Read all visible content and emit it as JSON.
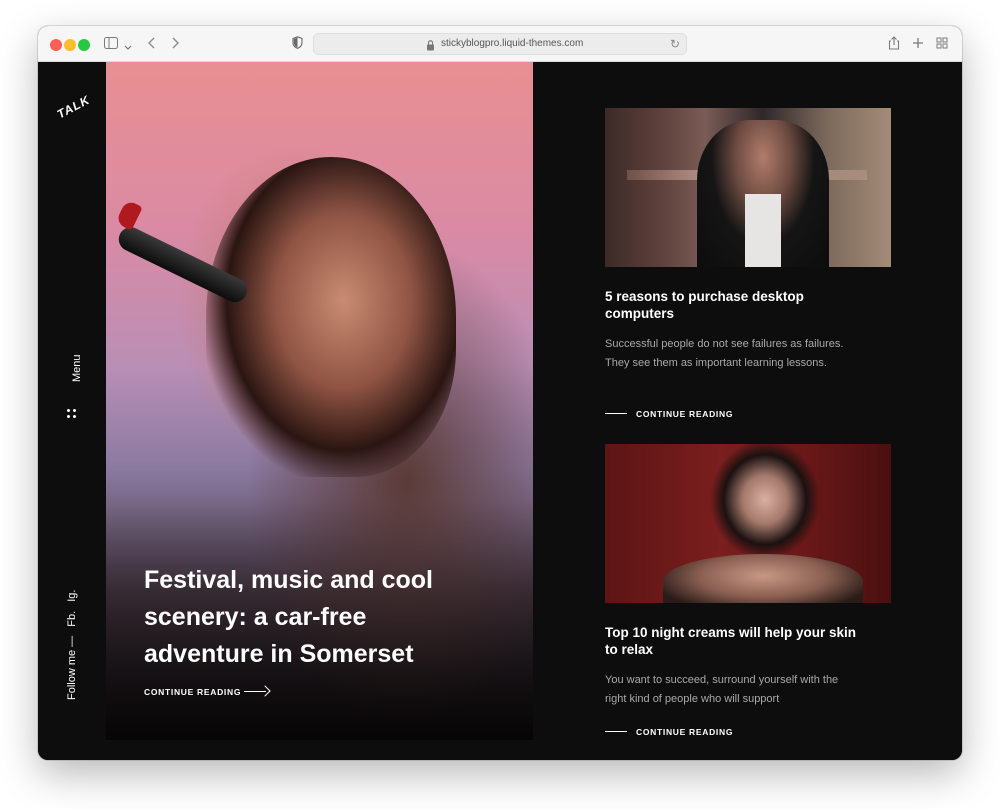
{
  "browser": {
    "url": "stickyblogpro.liquid-themes.com",
    "icons": [
      "sidebar-icon",
      "chevron-down-icon",
      "back-icon",
      "forward-icon",
      "shield-icon",
      "lock-icon",
      "reload-icon",
      "share-icon",
      "plus-icon",
      "tabs-grid-icon"
    ]
  },
  "sidebar": {
    "logo": "TALK",
    "menu_label": "Menu",
    "follow_label": "Follow me —",
    "social": [
      "Fb.",
      "Ig."
    ]
  },
  "hero": {
    "title": "Festival, music and cool scenery: a car-free adventure in Somerset",
    "cta": "CONTINUE READING"
  },
  "cards": [
    {
      "title": "5 reasons to purchase desktop computers",
      "excerpt": "Successful people do not see failures as failures. They see them as important learning lessons.",
      "cta": "CONTINUE READING"
    },
    {
      "title": "Top 10 night creams will help your skin to relax",
      "excerpt": "You want to succeed, surround yourself with the right kind of people who will support",
      "cta": "CONTINUE READING"
    }
  ],
  "colors": {
    "background": "#0d0d0d",
    "text": "#ffffff",
    "excerpt": "#a9a9a9",
    "close": "#ff5f57",
    "minimize": "#febc2e",
    "zoom": "#28c840"
  }
}
